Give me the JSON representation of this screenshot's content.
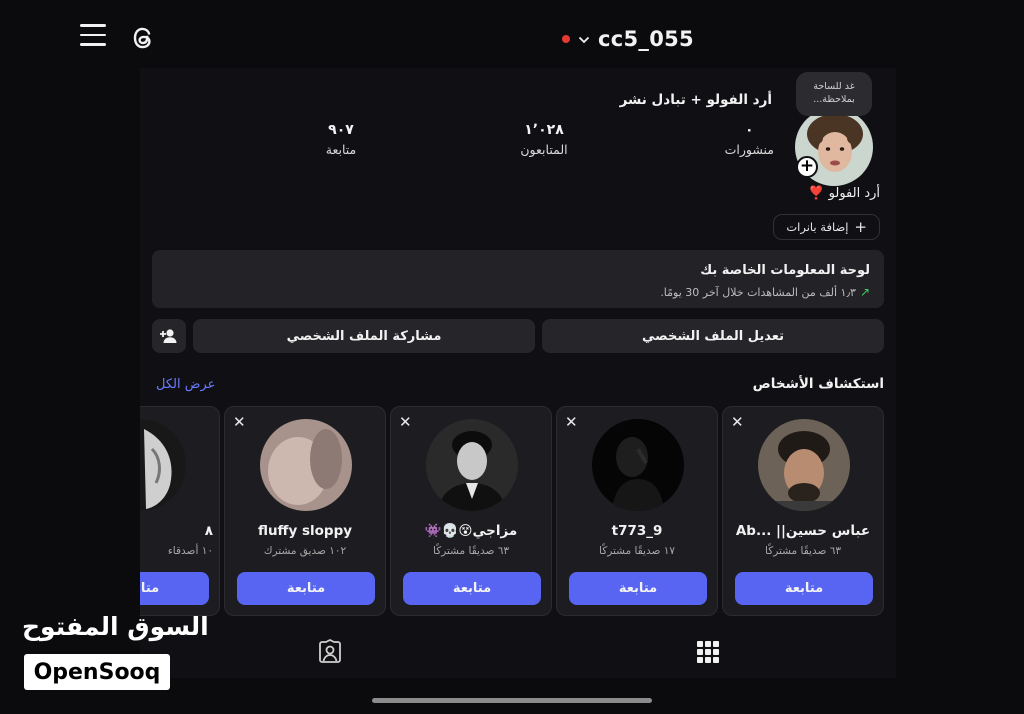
{
  "header": {
    "username": "cc5_055",
    "menu_icon": "hamburger-icon",
    "threads_icon": "threads-icon"
  },
  "profile": {
    "note": "غد للساحة بملاحظة...",
    "bio": "أرد الفولو + تبادل نشر",
    "display_name": "أرد الفولو ❣️",
    "stats": [
      {
        "value": "٠",
        "label": "منشورات"
      },
      {
        "value": "١٬٠٢٨",
        "label": "المتابعون"
      },
      {
        "value": "٩٠٧",
        "label": "متابعة"
      }
    ],
    "add_banners_label": "إضافة بانرات"
  },
  "dashboard": {
    "title": "لوحة المعلومات الخاصة بك",
    "subtitle": "١٫٣ ألف من المشاهدات خلال آخر 30 يومًا."
  },
  "actions": {
    "edit_profile": "تعديل الملف الشخصي",
    "share_profile": "مشاركة الملف الشخصي"
  },
  "discover": {
    "title": "استكشاف الأشخاص",
    "see_all": "عرض الكل",
    "follow_label": "متابعة",
    "people": [
      {
        "name": "عباس حسين|| ...Ab",
        "mutual": "٦٣ صديقًا مشتركًا"
      },
      {
        "name": "t773_9",
        "mutual": "١٧ صديقًا مشتركًا"
      },
      {
        "name": "مزاجي😵💀👾",
        "mutual": "٦٣ صديقًا مشتركًا"
      },
      {
        "name": "fluffy sloppy",
        "mutual": "١٠٢ صديق مشترك"
      },
      {
        "name": "٨",
        "mutual": "١٠ أصدقاء"
      }
    ]
  },
  "watermark": {
    "arabic": "السوق المفتوح",
    "latin": "OpenSooq"
  },
  "colors": {
    "accent": "#5865f2",
    "link": "#6b7bff",
    "live_dot": "#e53935",
    "trend_up": "#3ecf5c"
  }
}
